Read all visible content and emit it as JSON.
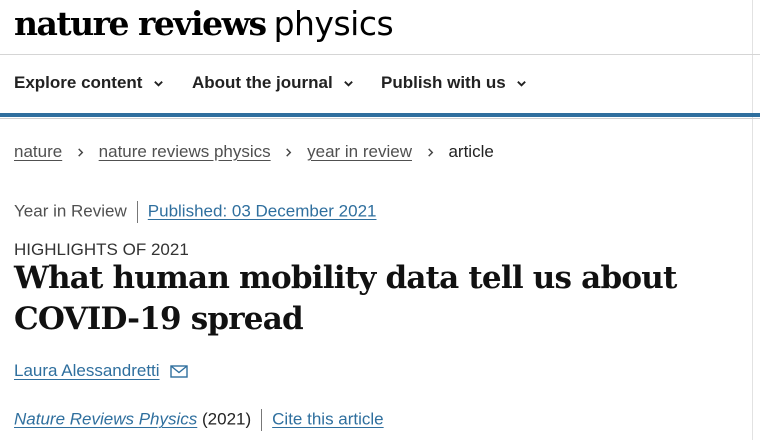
{
  "site": {
    "logo_bold": "nature reviews",
    "logo_light": "physics"
  },
  "nav": {
    "items": [
      {
        "label": "Explore content"
      },
      {
        "label": "About the journal"
      },
      {
        "label": "Publish with us"
      }
    ]
  },
  "breadcrumb": {
    "items": [
      {
        "label": "nature"
      },
      {
        "label": "nature reviews physics"
      },
      {
        "label": "year in review"
      }
    ],
    "current": "article"
  },
  "article": {
    "type": "Year in Review",
    "published": "Published: 03 December 2021",
    "kicker": "HIGHLIGHTS OF 2021",
    "title": "What human mobility data tell us about COVID-19 spread",
    "author": "Laura Alessandretti",
    "journal": "Nature Reviews Physics",
    "year": "(2021)",
    "cite_label": "Cite this article"
  },
  "colors": {
    "accent_blue": "#2f6f9e",
    "text_dark": "#222222",
    "text_grey": "#505050"
  }
}
